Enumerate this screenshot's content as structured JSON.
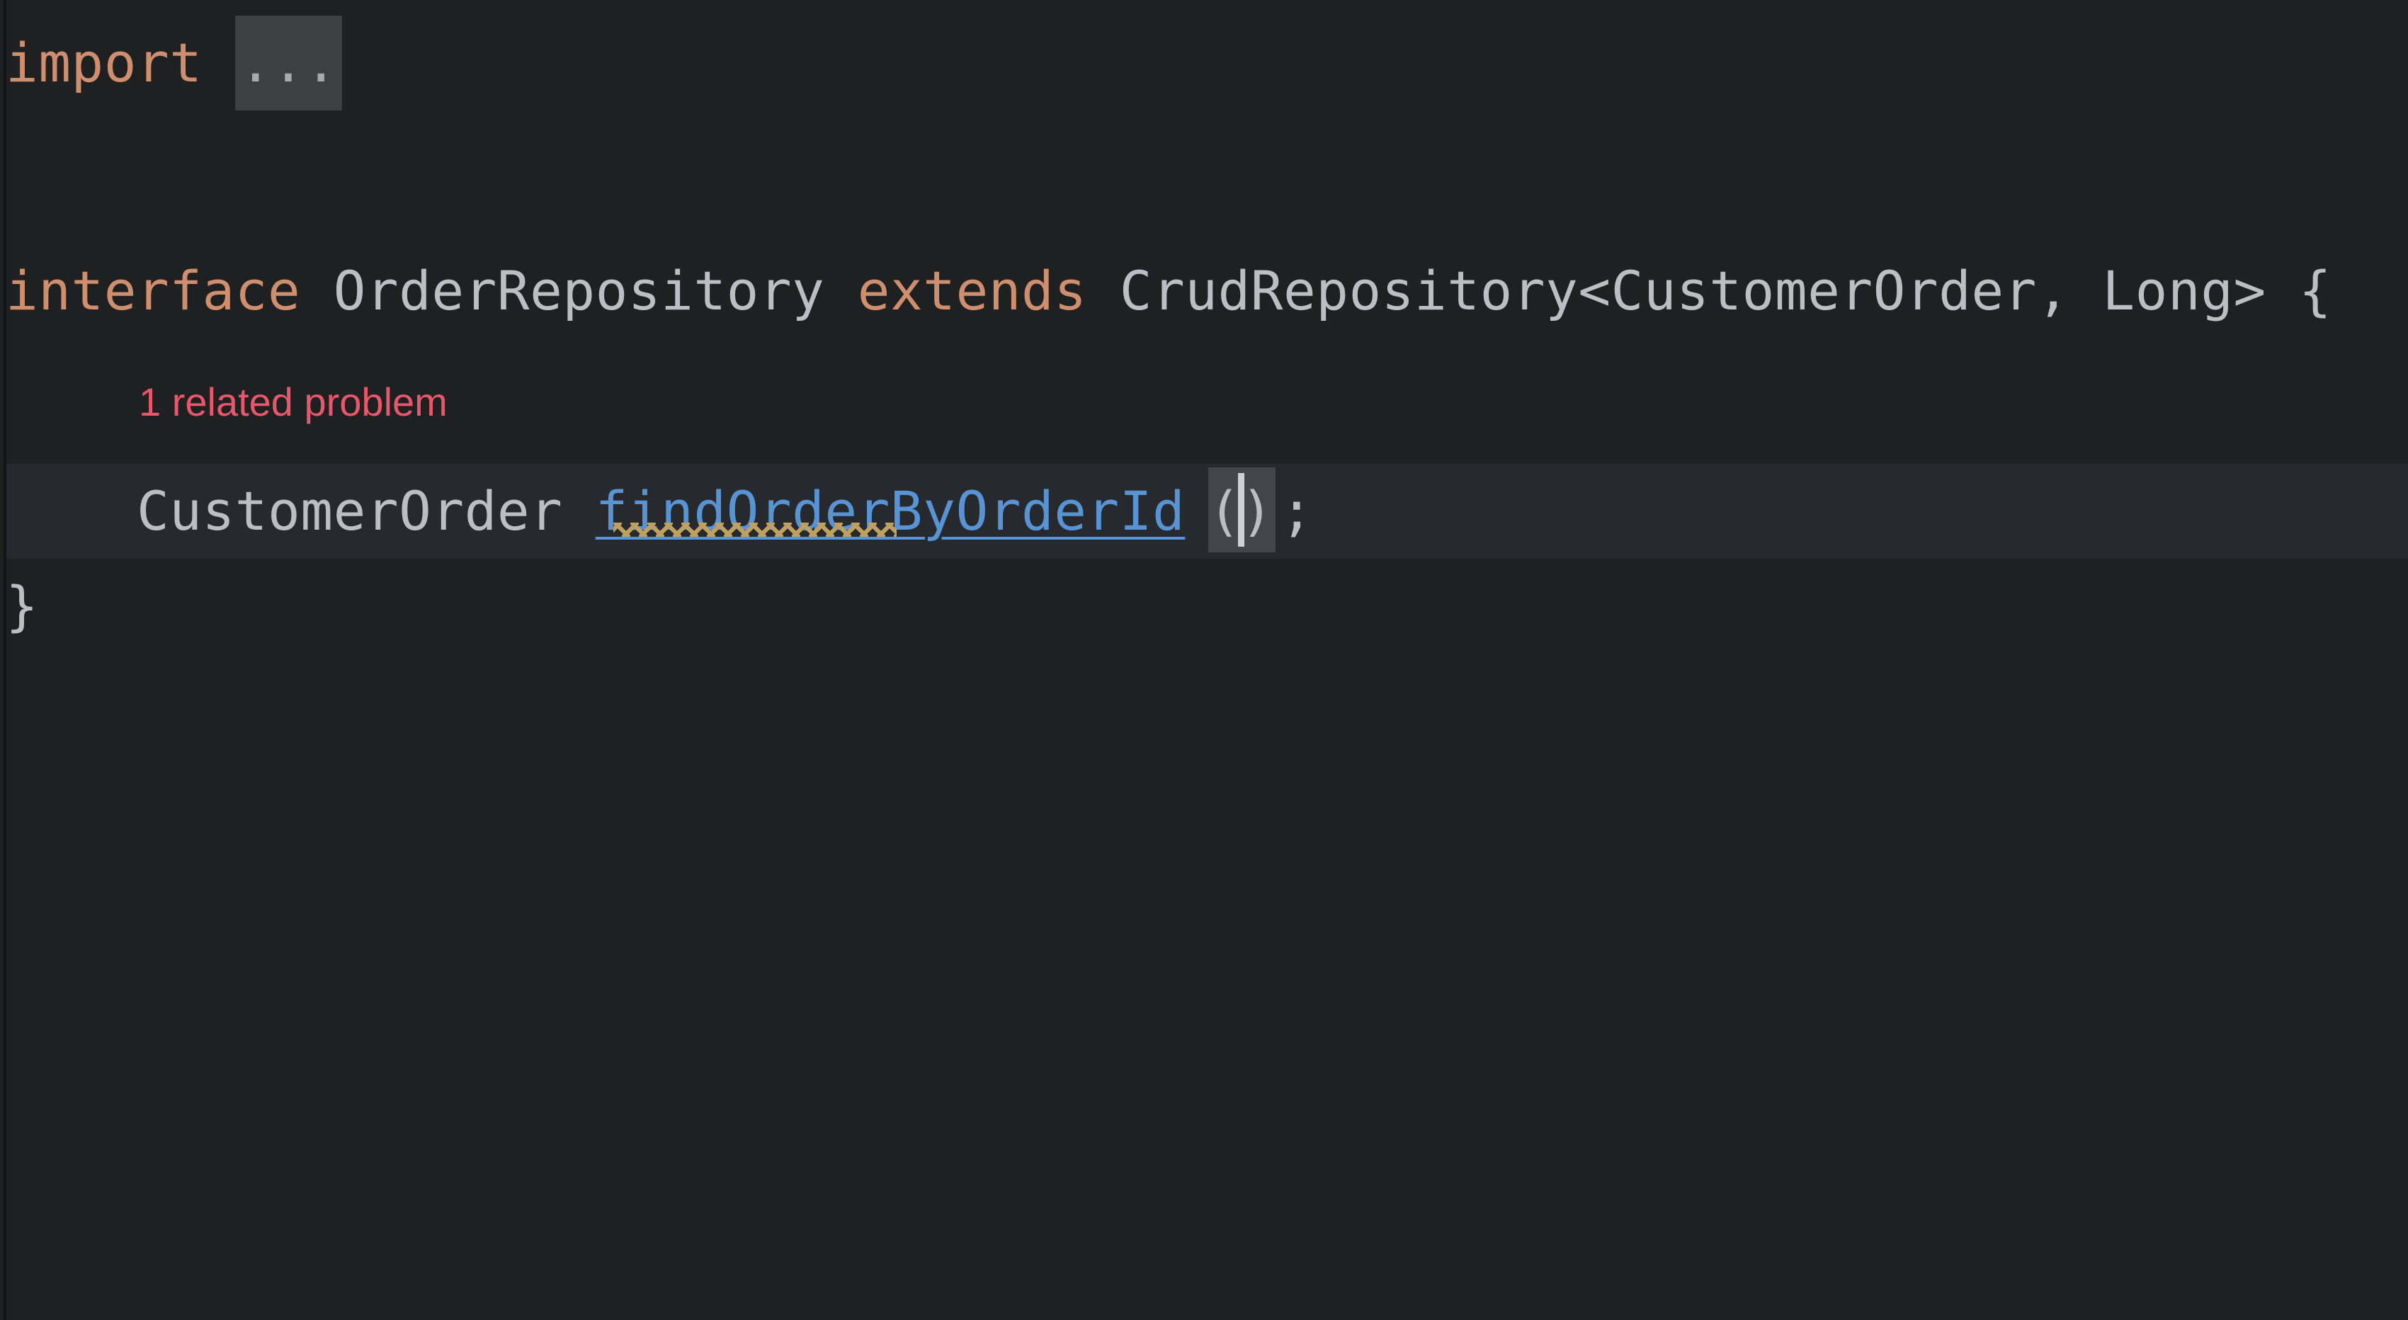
{
  "editor": {
    "language": "Java",
    "theme": "dark",
    "background_color": "#1e2022",
    "current_line_highlight_color": "#26292e",
    "default_text_color": "#bcbec4",
    "keyword_color": "#cf8e6d",
    "method_name_color": "#5894d4",
    "inlay_hint_color": "#e8576b",
    "warning_squiggle_color": "#bfa05f",
    "bracket_highlight_color": "#43454a",
    "fold_placeholder_color": "#3c4043",
    "caret_color": "#cdd0d4"
  },
  "code": {
    "line_import": {
      "keyword": "import",
      "space": " ",
      "fold_placeholder": "..."
    },
    "line_interface": {
      "keyword": "interface",
      "space_1": " ",
      "type_name": "OrderRepository",
      "space_2": " ",
      "extends_keyword": "extends",
      "space_3": " ",
      "super_type": "CrudRepository<CustomerOrder, Long> {"
    },
    "line_method": {
      "indent": "    ",
      "return_type": "CustomerOrder",
      "space": " ",
      "method_name": "findOrderByOrderId",
      "parens": "()",
      "terminator": ";"
    },
    "line_close": {
      "brace": "}"
    }
  },
  "inlay": {
    "related_problem_hint": "1 related problem"
  }
}
